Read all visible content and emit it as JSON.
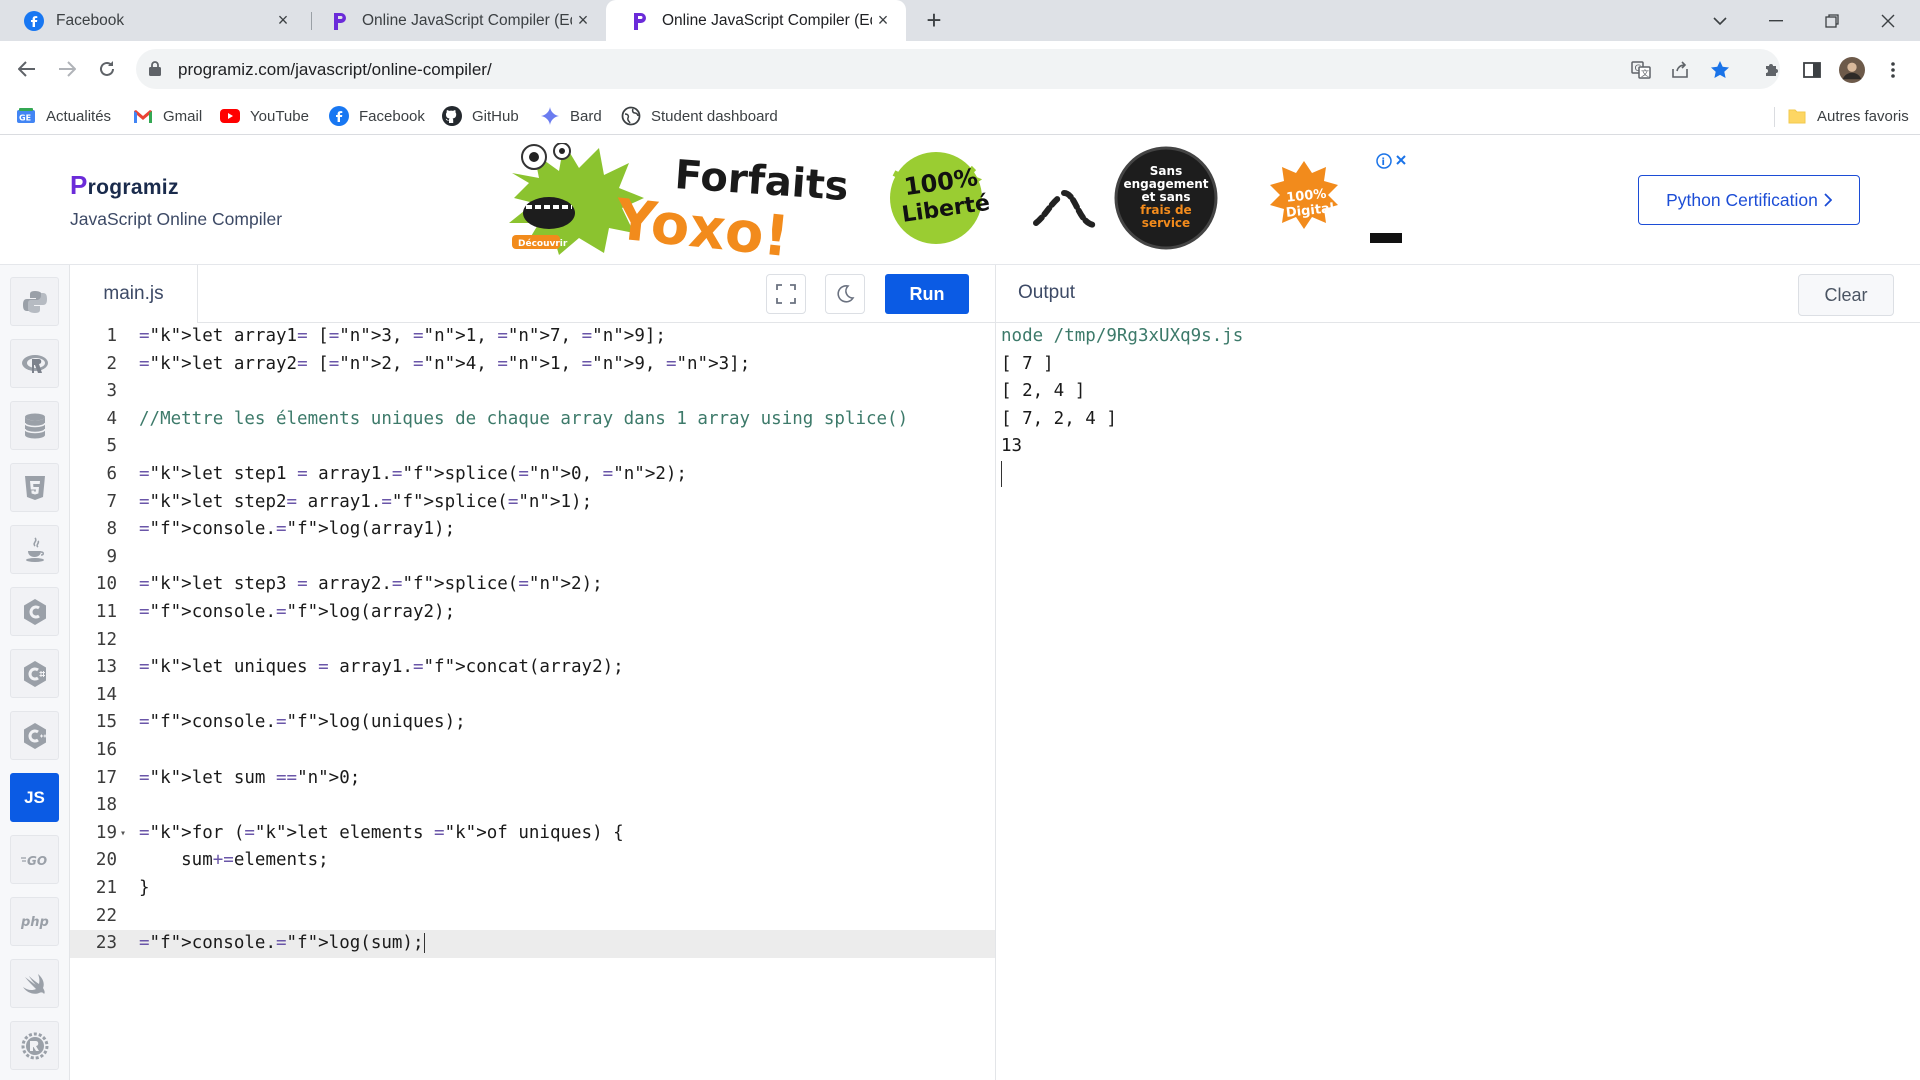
{
  "browser": {
    "tabs": [
      {
        "title": "Facebook",
        "icon": "facebook-icon"
      },
      {
        "title": "Online JavaScript Compiler (Editor)",
        "icon": "programiz-icon"
      },
      {
        "title": "Online JavaScript Compiler (Editor)",
        "icon": "programiz-icon",
        "active": true
      }
    ],
    "url": "programiz.com/javascript/online-compiler/",
    "bookmarks": [
      {
        "label": "Actualités",
        "icon": "google-news-icon"
      },
      {
        "label": "Gmail",
        "icon": "gmail-icon"
      },
      {
        "label": "YouTube",
        "icon": "youtube-icon"
      },
      {
        "label": "Facebook",
        "icon": "facebook-icon"
      },
      {
        "label": "GitHub",
        "icon": "github-icon"
      },
      {
        "label": "Bard",
        "icon": "bard-icon"
      },
      {
        "label": "Student dashboard",
        "icon": "globe-icon"
      }
    ],
    "other_bookmarks": "Autres favoris"
  },
  "site": {
    "logo": "rogramiz",
    "logo_initial": "P",
    "subtitle": "JavaScript Online Compiler",
    "cert_button": "Python Certification",
    "ad": {
      "headline": "Forfaits",
      "brand": "Yoxo!",
      "badge1_line1": "100%",
      "badge1_line2": "Liberté",
      "badge2": [
        "Sans",
        "engagement",
        "et sans",
        "frais de",
        "service"
      ],
      "badge3_line1": "100%",
      "badge3_line2": "Digital",
      "cta": "Découvrir"
    }
  },
  "compiler": {
    "languages": [
      {
        "name": "python-lang",
        "glyph": "🐍"
      },
      {
        "name": "r-lang",
        "glyph": "R"
      },
      {
        "name": "sql-lang",
        "glyph": "≋"
      },
      {
        "name": "html-lang",
        "glyph": "5"
      },
      {
        "name": "java-lang",
        "glyph": "☕"
      },
      {
        "name": "c-lang",
        "glyph": "C"
      },
      {
        "name": "csharp-lang",
        "glyph": "C#"
      },
      {
        "name": "cpp-lang",
        "glyph": "C+"
      },
      {
        "name": "js-lang",
        "glyph": "JS",
        "active": true
      },
      {
        "name": "go-lang",
        "glyph": "GO"
      },
      {
        "name": "php-lang",
        "glyph": "php"
      },
      {
        "name": "swift-lang",
        "glyph": "➶"
      },
      {
        "name": "rust-lang",
        "glyph": "®"
      }
    ],
    "file_name": "main.js",
    "run_label": "Run",
    "output_title": "Output",
    "clear_label": "Clear",
    "code_lines": [
      "let array1= [3, 1, 7, 9];",
      "let array2= [2, 4, 1, 9, 3];",
      "",
      "//Mettre les élements uniques de chaque array dans 1 array using splice()",
      "",
      "let step1 = array1.splice(0, 2);",
      "let step2= array1.splice(1);",
      "console.log(array1);",
      "",
      "let step3 = array2.splice(2);",
      "console.log(array2);",
      "",
      "let uniques = array1.concat(array2);",
      "",
      "console.log(uniques);",
      "",
      "let sum =0;",
      "",
      "for (let elements of uniques) {",
      "    sum+=elements;",
      "}",
      "",
      "console.log(sum);"
    ],
    "current_line": 23,
    "output_lines": [
      "node /tmp/9Rg3xUXq9s.js",
      "[ 7 ]",
      "[ 2, 4 ]",
      "[ 7, 2, 4 ]",
      "13"
    ]
  }
}
